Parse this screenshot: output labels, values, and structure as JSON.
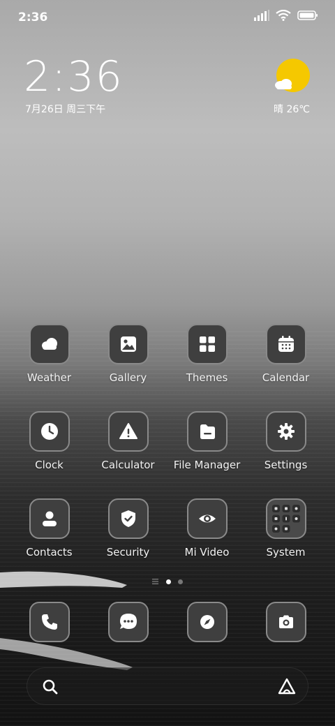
{
  "status_bar": {
    "time": "2:36"
  },
  "lockclock": {
    "time": "2:36",
    "date": "7月26日 周三下午"
  },
  "weather_widget": {
    "text": "晴 26℃",
    "sun_color": "#f5c800"
  },
  "apps": [
    {
      "label": "Weather",
      "icon": "weather-cloud-icon"
    },
    {
      "label": "Gallery",
      "icon": "image-icon"
    },
    {
      "label": "Themes",
      "icon": "grid-four-icon"
    },
    {
      "label": "Calendar",
      "icon": "calendar-icon"
    },
    {
      "label": "Clock",
      "icon": "clock-icon"
    },
    {
      "label": "Calculator",
      "icon": "warning-triangle-icon"
    },
    {
      "label": "File Manager",
      "icon": "folder-icon"
    },
    {
      "label": "Settings",
      "icon": "gear-icon"
    },
    {
      "label": "Contacts",
      "icon": "person-icon"
    },
    {
      "label": "Security",
      "icon": "shield-check-icon"
    },
    {
      "label": "Mi Video",
      "icon": "eye-icon"
    },
    {
      "label": "System",
      "icon": "folder-grid-icon"
    }
  ],
  "page_indicator": {
    "pages": 2,
    "active": 1
  },
  "dock": [
    {
      "icon": "phone-icon"
    },
    {
      "icon": "message-icon"
    },
    {
      "icon": "compass-icon"
    },
    {
      "icon": "camera-icon"
    }
  ],
  "search": {
    "search_icon": "search-icon",
    "assistant_icon": "assistant-icon"
  }
}
